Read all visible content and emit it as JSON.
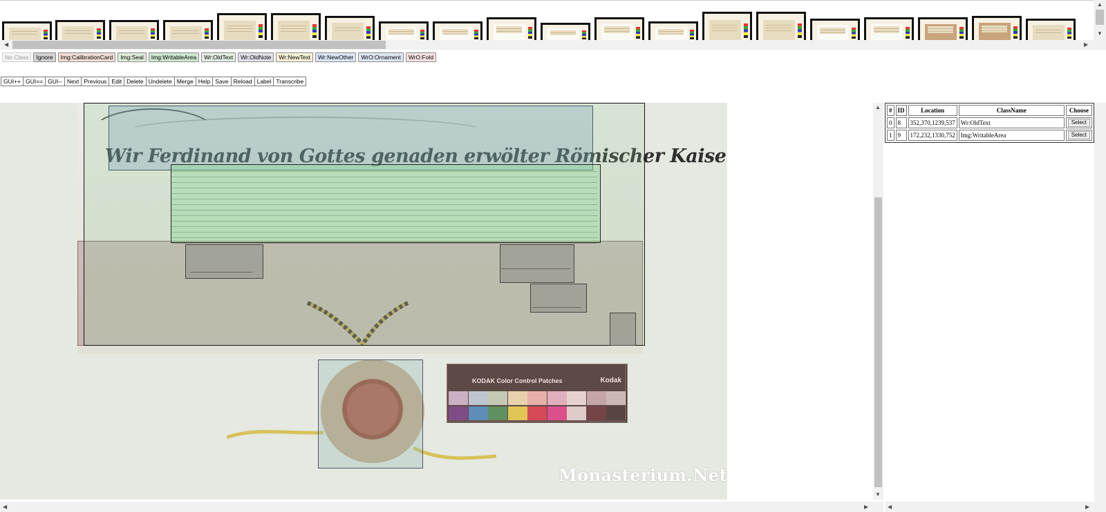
{
  "thumbnails": [
    {
      "name": "thumb-1",
      "variant": "",
      "selected": false
    },
    {
      "name": "thumb-2",
      "variant": "",
      "selected": false
    },
    {
      "name": "thumb-3",
      "variant": "seal",
      "selected": false
    },
    {
      "name": "thumb-4",
      "variant": "seal",
      "selected": false
    },
    {
      "name": "thumb-5",
      "variant": "",
      "selected": false
    },
    {
      "name": "thumb-6",
      "variant": "",
      "selected": false
    },
    {
      "name": "thumb-7",
      "variant": "seal",
      "selected": false
    },
    {
      "name": "thumb-8",
      "variant": "white",
      "selected": false
    },
    {
      "name": "thumb-9",
      "variant": "white",
      "selected": false
    },
    {
      "name": "thumb-10",
      "variant": "white",
      "selected": false
    },
    {
      "name": "thumb-11",
      "variant": "white",
      "selected": false
    },
    {
      "name": "thumb-12",
      "variant": "white",
      "selected": false
    },
    {
      "name": "thumb-13",
      "variant": "white",
      "selected": false
    },
    {
      "name": "thumb-14",
      "variant": "",
      "selected": false
    },
    {
      "name": "thumb-15",
      "variant": "",
      "selected": false
    },
    {
      "name": "thumb-16",
      "variant": "white",
      "selected": false
    },
    {
      "name": "thumb-17",
      "variant": "white",
      "selected": false
    },
    {
      "name": "thumb-18",
      "variant": "brown",
      "selected": false
    },
    {
      "name": "thumb-19",
      "variant": "brown",
      "selected": false
    },
    {
      "name": "thumb-20",
      "variant": "",
      "selected": false
    }
  ],
  "class_buttons": [
    {
      "label": "No Class",
      "style": "disabled"
    },
    {
      "label": "Ignore",
      "style": "c-ignore"
    },
    {
      "label": "Img:CalibrationCard",
      "style": "c-cal"
    },
    {
      "label": "Img:Seal",
      "style": "c-seal"
    },
    {
      "label": "Img:WritableArea",
      "style": "c-writ"
    },
    {
      "label": "Wr:OldText",
      "style": "c-oldtext"
    },
    {
      "label": "Wr:OldNote",
      "style": "c-oldnote"
    },
    {
      "label": "Wr:NewText",
      "style": "c-newtext"
    },
    {
      "label": "Wr:NewOther",
      "style": "c-newother"
    },
    {
      "label": "WrO:Ornament",
      "style": "c-orn"
    },
    {
      "label": "WrO:Fold",
      "style": "c-fold"
    }
  ],
  "toolbar": [
    "GUI++",
    "GUI==",
    "GUI--",
    "Next",
    "Previous",
    "Edit",
    "Delete",
    "Undelete",
    "Merge",
    "Help",
    "Save",
    "Reload",
    "Label",
    "Transcribe"
  ],
  "document": {
    "title_line": "Wir Ferdinand von Gottes genaden erwölter Römischer Kaiser zu allen zeitten merer",
    "card_title": "KODAK Color Control Patches",
    "card_brand": "Kodak",
    "card_swatches": [
      "#c9b8d9",
      "#b6d6ea",
      "#bddcbf",
      "#f2e7b6",
      "#f1b7b1",
      "#e6b6cf",
      "#eceae6",
      "#c1a9ad",
      "#c9c5c2",
      "#5b2a7e",
      "#2b86c8",
      "#2e8a46",
      "#e9d73c",
      "#d9253d",
      "#de2f86",
      "#e4e0dc",
      "#4c1e24",
      "#241f1e"
    ],
    "watermark": "Monasterium.Net"
  },
  "table": {
    "headers": [
      "#",
      "ID",
      "Location",
      "ClassName",
      "Choose"
    ],
    "rows": [
      {
        "idx": "0",
        "id": "8",
        "location": "352,370,1239,537",
        "classname": "Wr:OldText",
        "choose": "Select"
      },
      {
        "idx": "1",
        "id": "9",
        "location": "172,232,1330,752",
        "classname": "Img:WritableArea",
        "choose": "Select"
      }
    ]
  },
  "colors": {
    "writable_area_overlay": "#87d796",
    "old_text_overlay": "#6e96b4",
    "fold_overlay": "#96696e",
    "seal_overlay": "#96beb4"
  }
}
